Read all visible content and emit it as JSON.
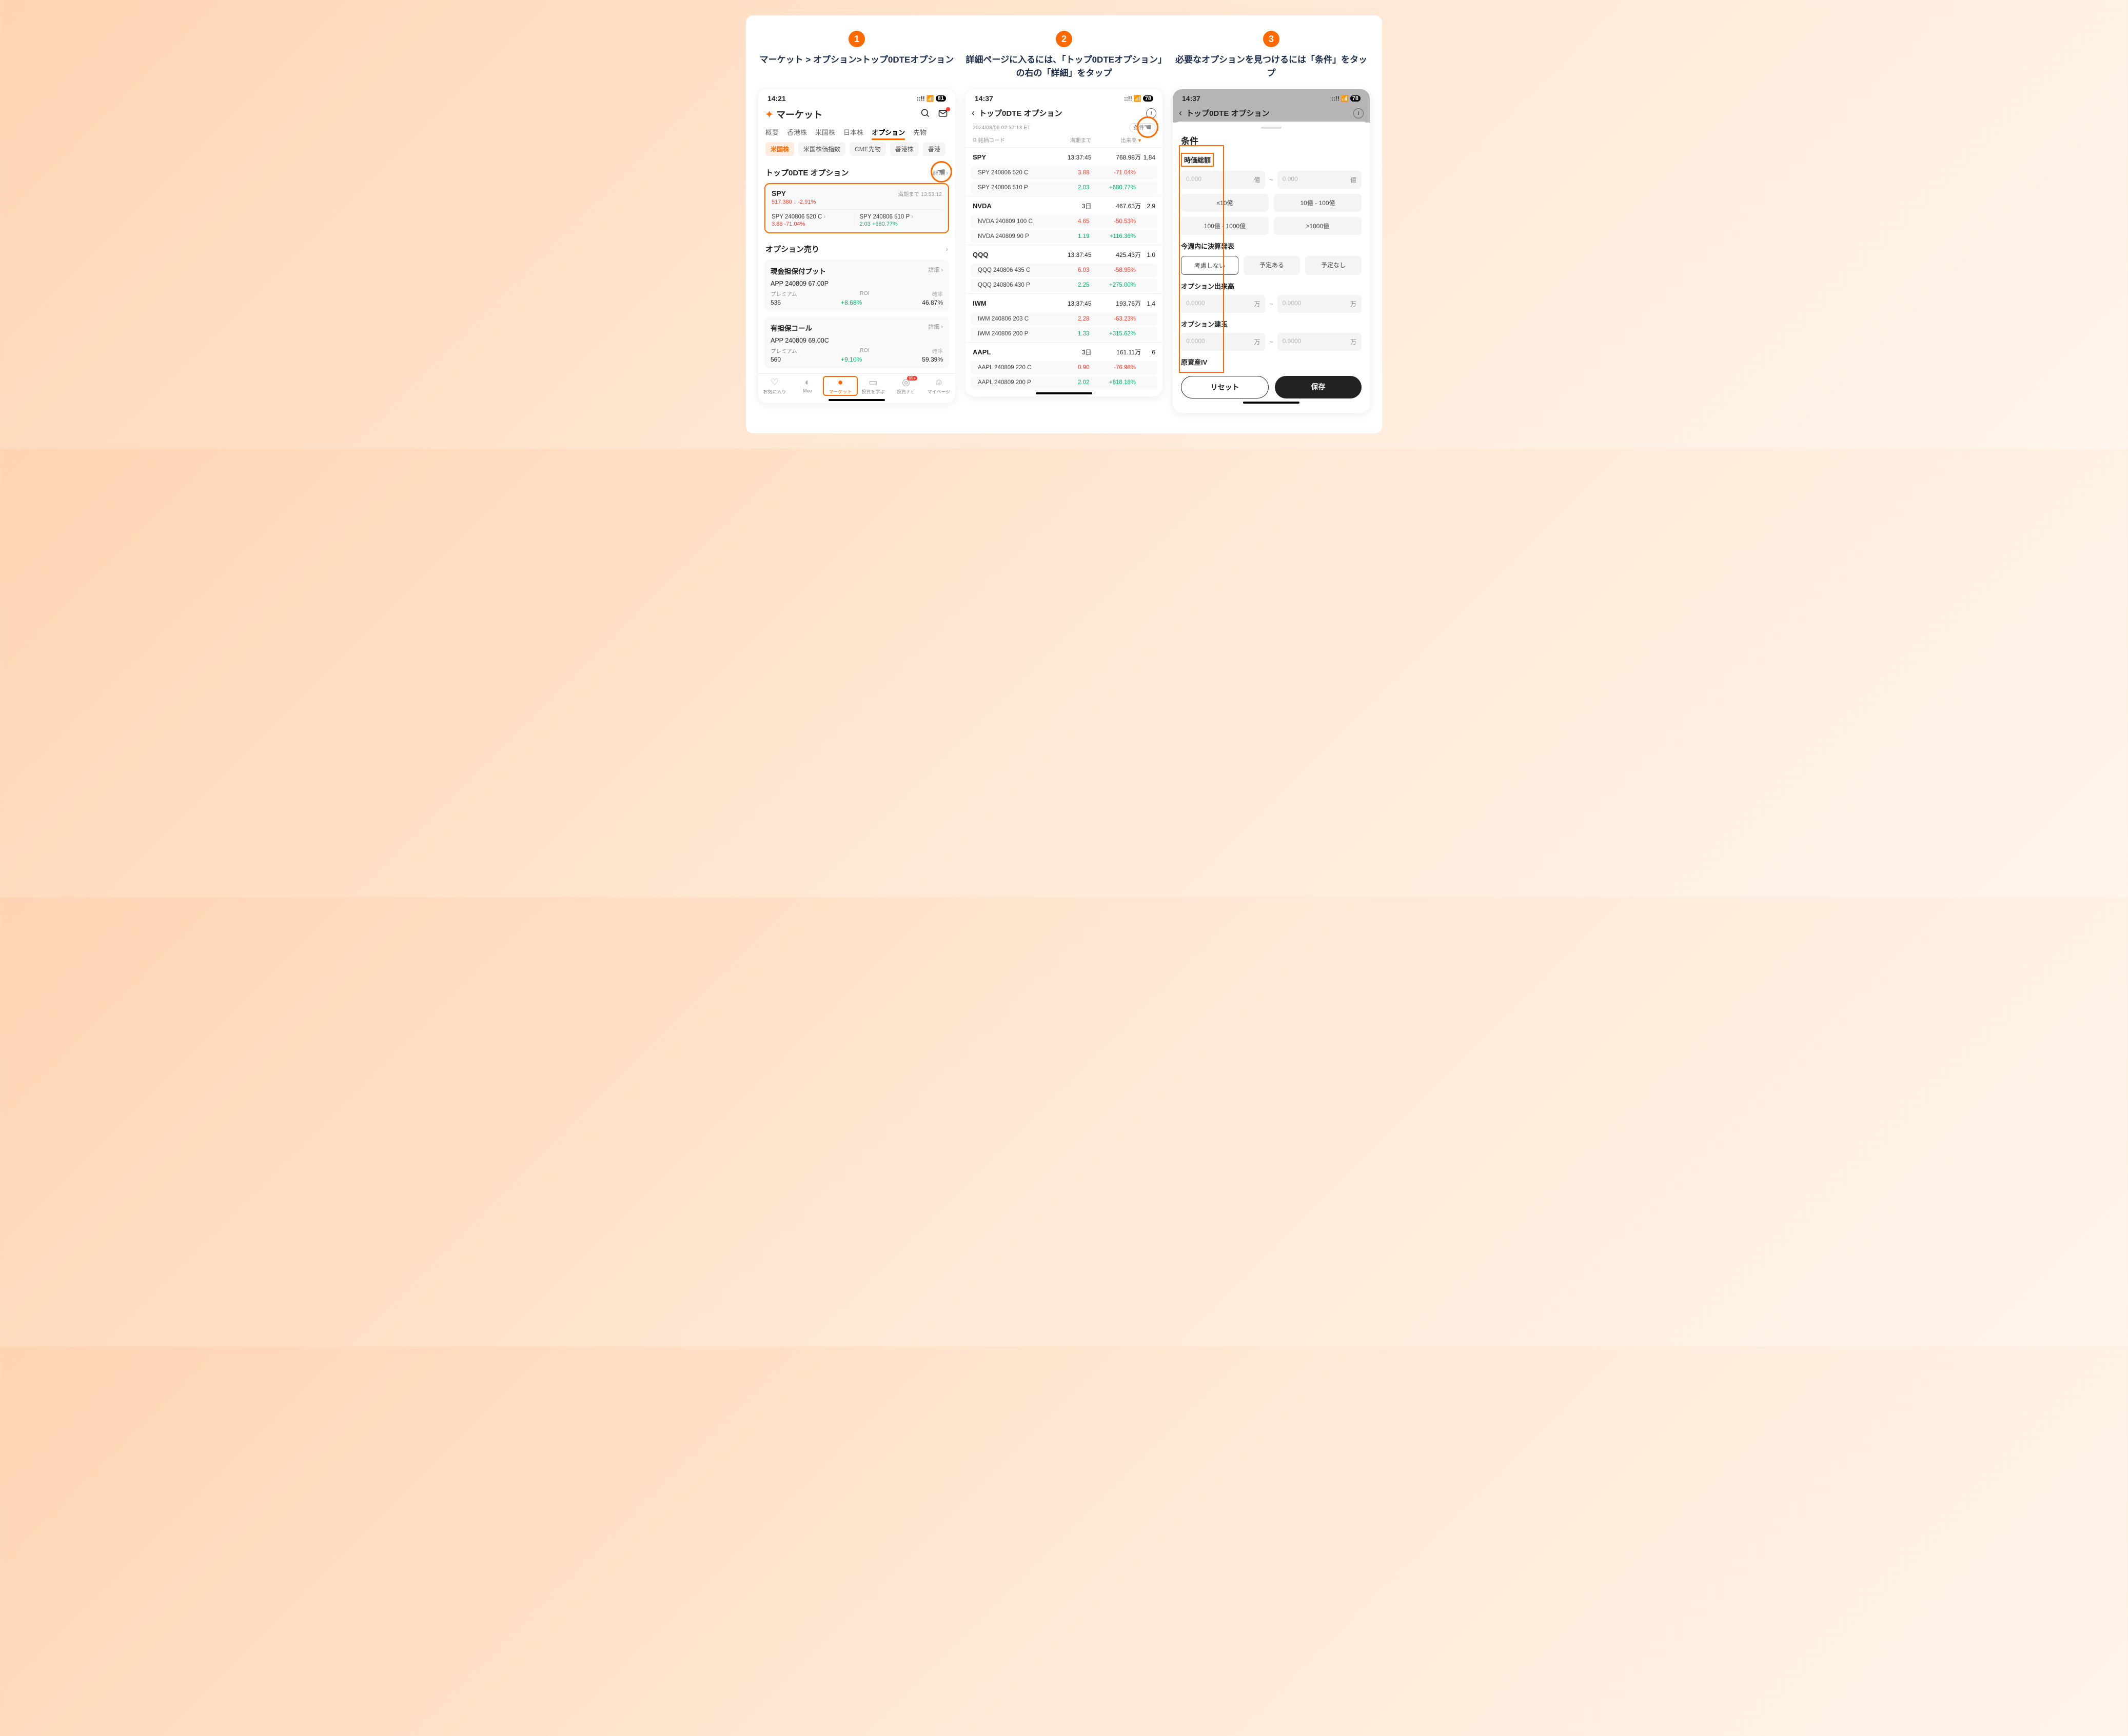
{
  "steps": {
    "s1": {
      "num": "1",
      "title": "マーケット > オプション>トップ0DTEオプション"
    },
    "s2": {
      "num": "2",
      "title": "詳細ページに入るには、「トップ0DTEオプション」の右の「詳細」をタップ"
    },
    "s3": {
      "num": "3",
      "title": "必要なオプションを見つけるには「条件」をタップ"
    }
  },
  "screen1": {
    "time": "14:21",
    "battery": "81",
    "app_title": "マーケット",
    "tabs": [
      "概要",
      "香港株",
      "米国株",
      "日本株",
      "オプション",
      "先物"
    ],
    "tabs_active_idx": 4,
    "chips": [
      "米国株",
      "米国株価指数",
      "CME先物",
      "香港株",
      "香港"
    ],
    "chips_active_idx": 0,
    "section_top0dte": "トップ0DTE オプション",
    "detail_label": "詳細",
    "spy": {
      "sym": "SPY",
      "price": "517.380",
      "chg": "-2.91%",
      "countdown_label": "満期まで 13:53:12",
      "left": {
        "name": "SPY 240806 520 C",
        "px": "3.88",
        "chg": "-71.04%"
      },
      "right": {
        "name": "SPY 240806 510 P",
        "px": "2.03",
        "chg": "+680.77%"
      }
    },
    "section_sell": "オプション売り",
    "cashput": {
      "title": "現金担保付プット",
      "name": "APP 240809 67.00P",
      "premium_label": "プレミアム",
      "premium": "535",
      "roi_label": "ROI",
      "roi": "+8.68%",
      "prob_label": "確率",
      "prob": "46.87%"
    },
    "covcall": {
      "title": "有担保コール",
      "name": "APP 240809 69.00C",
      "premium_label": "プレミアム",
      "premium": "560",
      "roi_label": "ROI",
      "roi": "+9.10%",
      "prob_label": "確率",
      "prob": "59.39%"
    },
    "nav": {
      "fav": "お気に入り",
      "moo": "Moo",
      "market": "マーケット",
      "learn": "投資を学ぶ",
      "navi": "投資ナビ",
      "mypage": "マイページ",
      "badge": "99+"
    }
  },
  "screen2": {
    "time": "14:37",
    "battery": "78",
    "title": "トップ0DTE オプション",
    "ts": "2024/08/06 02:37:13 ET",
    "cond_btn": "条件",
    "th": {
      "code": "銘柄コード",
      "exp": "満期まで",
      "vol": "出来高"
    },
    "groups": [
      {
        "sym": "SPY",
        "exp": "13:37:45",
        "vol": "768.98万",
        "extra": "1,84",
        "rows": [
          {
            "name": "SPY 240806 520 C",
            "px": "3.88",
            "chg": "-71.04%",
            "dir": "down"
          },
          {
            "name": "SPY 240806 510 P",
            "px": "2.03",
            "chg": "+680.77%",
            "dir": "up"
          }
        ]
      },
      {
        "sym": "NVDA",
        "exp": "3日",
        "vol": "467.63万",
        "extra": "2,9",
        "rows": [
          {
            "name": "NVDA 240809 100 C",
            "px": "4.65",
            "chg": "-50.53%",
            "dir": "down"
          },
          {
            "name": "NVDA 240809 90 P",
            "px": "1.19",
            "chg": "+116.36%",
            "dir": "up"
          }
        ]
      },
      {
        "sym": "QQQ",
        "exp": "13:37:45",
        "vol": "425.43万",
        "extra": "1,0",
        "rows": [
          {
            "name": "QQQ 240806 435 C",
            "px": "6.03",
            "chg": "-58.95%",
            "dir": "down"
          },
          {
            "name": "QQQ 240806 430 P",
            "px": "2.25",
            "chg": "+275.00%",
            "dir": "up"
          }
        ]
      },
      {
        "sym": "IWM",
        "exp": "13:37:45",
        "vol": "193.76万",
        "extra": "1,4",
        "rows": [
          {
            "name": "IWM 240806 203 C",
            "px": "2.28",
            "chg": "-63.23%",
            "dir": "down"
          },
          {
            "name": "IWM 240806 200 P",
            "px": "1.33",
            "chg": "+315.62%",
            "dir": "up"
          }
        ]
      },
      {
        "sym": "AAPL",
        "exp": "3日",
        "vol": "161.11万",
        "extra": "6",
        "rows": [
          {
            "name": "AAPL 240809 220 C",
            "px": "0.90",
            "chg": "-76.98%",
            "dir": "down"
          },
          {
            "name": "AAPL 240809 200 P",
            "px": "2.02",
            "chg": "+818.18%",
            "dir": "up"
          }
        ]
      }
    ]
  },
  "screen3": {
    "time": "14:37",
    "battery": "78",
    "title": "トップ0DTE オプション",
    "sheet_title": "条件",
    "mcap_label": "時価総額",
    "range_ph": "0.000",
    "unit_oku": "億",
    "mcap_opts": [
      "≤10億",
      "10億 - 100億",
      "100億 - 1000億",
      "≥1000億"
    ],
    "earn_label": "今週内に決算発表",
    "earn_opts": [
      "考慮しない",
      "予定ある",
      "予定なし"
    ],
    "vol_label": "オプション出来高",
    "range_ph4": "0.0000",
    "unit_man": "万",
    "oi_label": "オプション建玉",
    "iv_label": "原資産IV",
    "reset": "リセット",
    "save": "保存"
  }
}
